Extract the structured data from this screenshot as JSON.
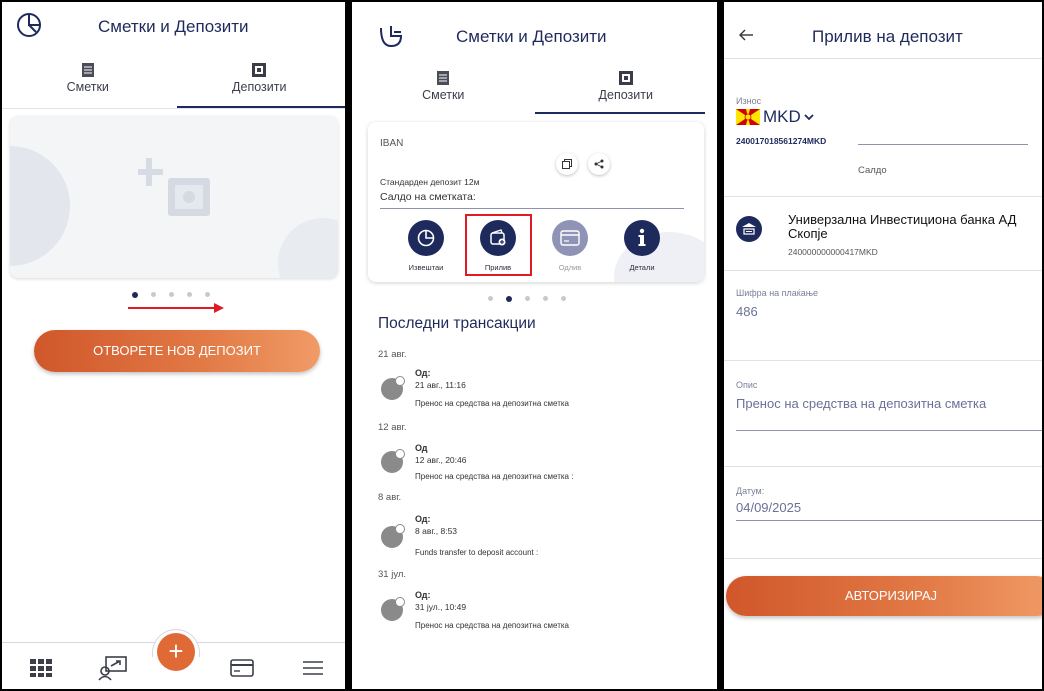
{
  "screen1": {
    "header_title": "Сметки и Депозити",
    "tabs": [
      "Сметки",
      "Депозити"
    ],
    "carousel_dots": 5,
    "open_deposit_label": "ОТВОРЕТЕ НОВ ДЕПОЗИТ"
  },
  "screen2": {
    "header_title": "Сметки и Депозити",
    "tabs": [
      "Сметки",
      "Депозити"
    ],
    "card": {
      "iban_label": "IBAN",
      "deposit_name": "Стандарден депозит 12м",
      "balance_label": "Салдо на сметката:"
    },
    "actions": [
      {
        "label": "Извештаи"
      },
      {
        "label": "Прилив"
      },
      {
        "label": "Одлив"
      },
      {
        "label": "Детали"
      }
    ],
    "recent_title": "Последни трансакции",
    "groups": [
      {
        "date": "21 авг.",
        "from": "Од:",
        "datetime": "21 авг., 11:16",
        "description": "Пренос на средства на депозитна сметка"
      },
      {
        "date": "12 авг.",
        "from": "Од",
        "datetime": "12 авг., 20:46",
        "description": "Пренос на средства на депозитна сметка :"
      },
      {
        "date": "8 авг.",
        "from": "Од:",
        "datetime": "8 авг., 8:53",
        "description": "Funds transfer to deposit account :"
      },
      {
        "date": "31 јул.",
        "from": "Од:",
        "datetime": "31 јул., 10:49",
        "description": "Пренос на средства на депозитна сметка"
      }
    ]
  },
  "screen3": {
    "header_title": "Прилив на депозит",
    "amount_label": "Износ",
    "currency": "MKD",
    "source_account": "240017018561274MKD",
    "balance_label": "Салдо",
    "bank_name": "Универзална Инвестициона банка АД Скопје",
    "bank_account": "240000000000417MKD",
    "payment_code_label": "Шифра на плаќање",
    "payment_code_value": "486",
    "description_label": "Опис",
    "description_value": "Пренос на средства на депозитна сметка",
    "date_label": "Датум:",
    "date_value": "04/09/2025",
    "authorize_label": "АВТОРИЗИРАЈ"
  },
  "colors": {
    "navy": "#1f2a5c",
    "orange_start": "#d0572a",
    "orange_end": "#f09b66",
    "highlight_red": "#e01b24"
  }
}
